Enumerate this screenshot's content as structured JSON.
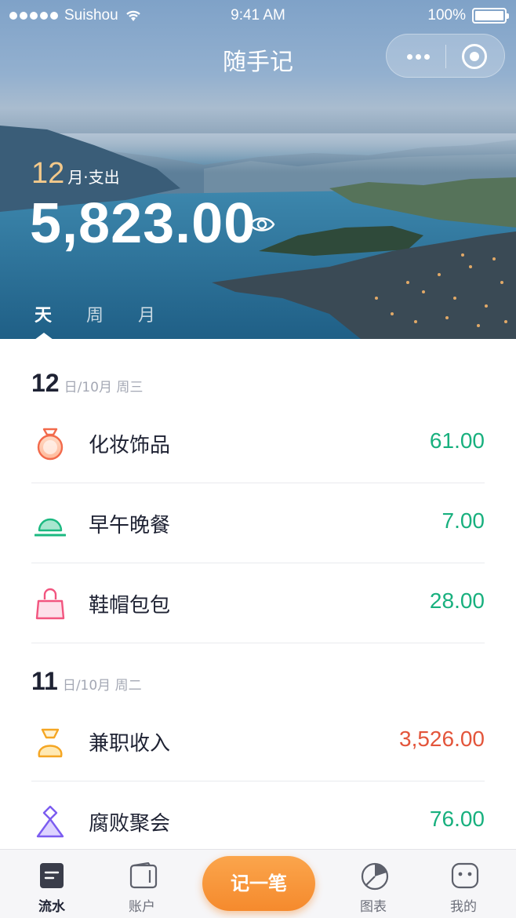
{
  "status_bar": {
    "carrier": "Suishou",
    "time": "9:41 AM",
    "battery": "100%"
  },
  "header": {
    "title": "随手记",
    "more_icon": "more-dots-icon",
    "close_icon": "target-close-icon"
  },
  "summary": {
    "month": "12",
    "month_suffix": "月·支出",
    "total": "5,823.00",
    "visibility_icon": "eye-icon"
  },
  "period_tabs": [
    {
      "label": "天",
      "active": true
    },
    {
      "label": "周",
      "active": false
    },
    {
      "label": "月",
      "active": false
    }
  ],
  "days": [
    {
      "day": "12",
      "meta": "日/10月  周三",
      "items": [
        {
          "icon": "ring-icon",
          "name": "化妆饰品",
          "amount": "61.00",
          "type": "expense"
        },
        {
          "icon": "food-cover-icon",
          "name": "早午晚餐",
          "amount": "7.00",
          "type": "expense"
        },
        {
          "icon": "handbag-icon",
          "name": "鞋帽包包",
          "amount": "28.00",
          "type": "expense"
        }
      ]
    },
    {
      "day": "11",
      "meta": "日/10月  周二",
      "items": [
        {
          "icon": "money-bag-icon",
          "name": "兼职收入",
          "amount": "3,526.00",
          "type": "income"
        },
        {
          "icon": "party-icon",
          "name": "腐败聚会",
          "amount": "76.00",
          "type": "expense"
        }
      ]
    }
  ],
  "tab_bar": {
    "items": [
      {
        "label": "流水",
        "icon": "ledger-icon",
        "active": true
      },
      {
        "label": "账户",
        "icon": "wallet-icon",
        "active": false
      },
      {
        "label": "图表",
        "icon": "pie-chart-icon",
        "active": false
      },
      {
        "label": "我的",
        "icon": "profile-face-icon",
        "active": false
      }
    ],
    "add_button": "记一笔"
  },
  "colors": {
    "expense": "#18b07e",
    "income": "#e3553b",
    "accent": "#f58a2d"
  }
}
